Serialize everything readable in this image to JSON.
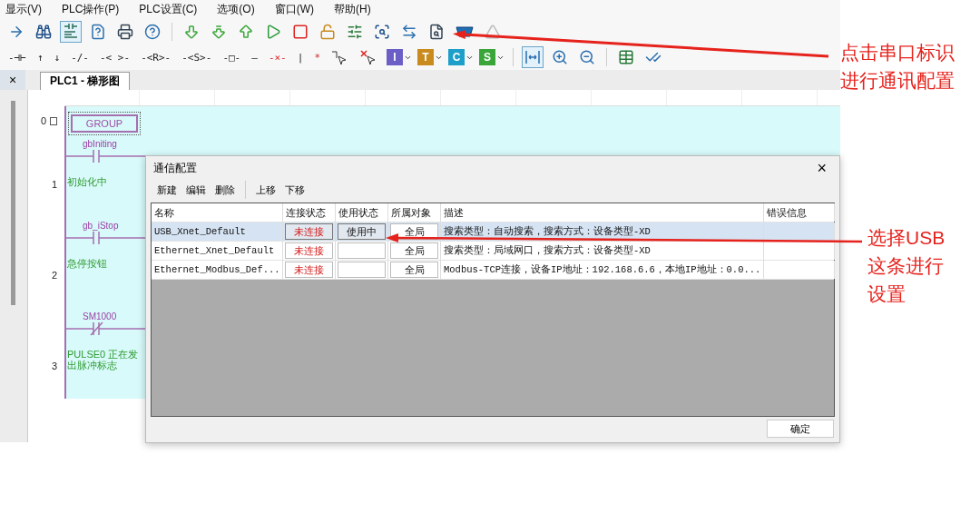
{
  "menu": [
    "显示(V)",
    "PLC操作(P)",
    "PLC设置(C)",
    "选项(O)",
    "窗口(W)",
    "帮助(H)"
  ],
  "toolbar2": {
    "glyphs": [
      "-⊣⊢",
      "↑",
      "↓",
      "-/-",
      "-< >-",
      "-<R>-",
      "-<S>-",
      "-□-",
      "—",
      "-×-",
      "|",
      "*"
    ],
    "letters": [
      {
        "text": "I",
        "color": "#6b5fc7"
      },
      {
        "text": "T",
        "color": "#c98a1e"
      },
      {
        "text": "C",
        "color": "#1e9fc9"
      },
      {
        "text": "S",
        "color": "#3aa63a"
      }
    ]
  },
  "panel_close": "×",
  "tabs": [
    {
      "label": "PLC1 - 梯形图",
      "selected": true
    }
  ],
  "ladder": {
    "rungs": [
      {
        "number": "0",
        "kind": "group",
        "label": "GROUP"
      },
      {
        "number": "1",
        "kind": "contact",
        "label": "gbIniting",
        "normally_closed": false,
        "comment": [
          "初始化中"
        ]
      },
      {
        "number": "2",
        "kind": "contact",
        "label": "gb_iStop",
        "normally_closed": false,
        "comment": [
          "急停按钮"
        ]
      },
      {
        "number": "3",
        "kind": "contact",
        "label": "SM1000",
        "normally_closed": true,
        "comment": [
          "PULSE0 正在发",
          "出脉冲标志"
        ]
      }
    ]
  },
  "dialog": {
    "title": "通信配置",
    "close": "×",
    "toolbar": [
      [
        "新建",
        "编辑",
        "删除"
      ],
      [
        "上移",
        "下移"
      ]
    ],
    "columns": [
      "名称",
      "连接状态",
      "使用状态",
      "所属对象",
      "描述",
      "错误信息"
    ],
    "rows": [
      {
        "name": "USB_Xnet_Default",
        "connection": "未连接",
        "usage": "使用中",
        "scope": "全局",
        "description": "搜索类型：自动搜索，搜索方式：设备类型-XD",
        "error": "",
        "selected": true
      },
      {
        "name": "Ethernet_Xnet_Default",
        "connection": "未连接",
        "usage": "",
        "scope": "全局",
        "description": "搜索类型：局域网口，搜索方式：设备类型-XD",
        "error": "",
        "selected": false
      },
      {
        "name": "Ethernet_Modbus_Def...",
        "connection": "未连接",
        "usage": "",
        "scope": "全局",
        "description": "Modbus-TCP连接，设备IP地址：192.168.6.6，本地IP地址：0.0...",
        "error": "",
        "selected": false
      }
    ],
    "ok": "确定"
  },
  "annotations": [
    {
      "lines": [
        "点击串口标识",
        "进行通讯配置"
      ]
    },
    {
      "lines": [
        "选择USB",
        "这条进行",
        "设置"
      ]
    }
  ]
}
